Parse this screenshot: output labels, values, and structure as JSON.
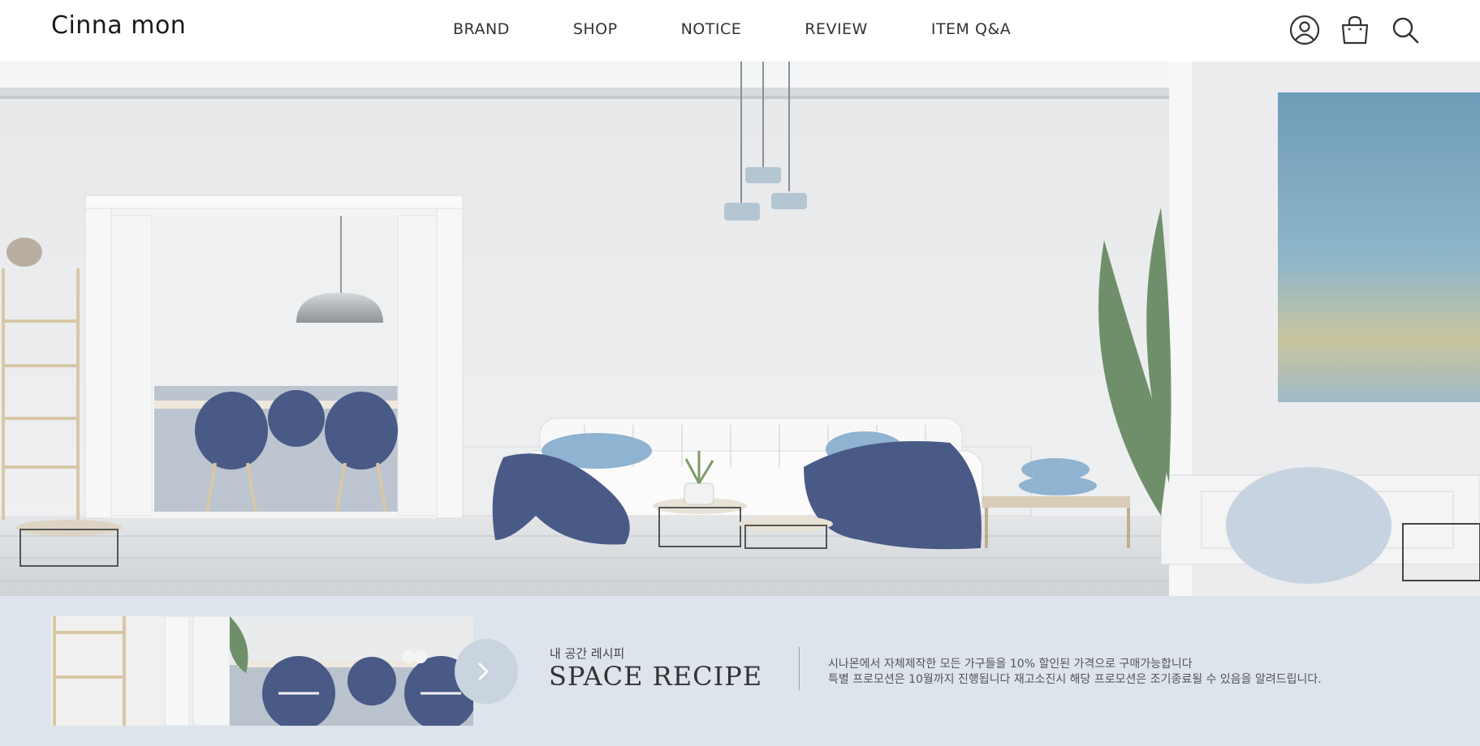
{
  "header": {
    "logo": "Cinna mon",
    "nav": [
      "BRAND",
      "SHOP",
      "NOTICE",
      "REVIEW",
      "ITEM Q&A"
    ],
    "icons": [
      "user-icon",
      "shopping-bag-icon",
      "search-icon"
    ]
  },
  "hero": {
    "image": "living-room-interior-illustration"
  },
  "promo": {
    "image": "dining-room-thumbnail",
    "arrow_icon": "chevron-right-icon",
    "subtitle": "내 공간 레시피",
    "title": "SPACE RECIPE",
    "description_line1": "시나몬에서 자체제작한 모든 가구들을 10% 할인된 가격으로 구매가능합니다",
    "description_line2": "특별 프로모션은 10월까지 진행됩니다 재고소진시 해당 프로모션은 조기종료될 수 있음을 알려드립니다."
  },
  "colors": {
    "promo_background": "#dde4ec",
    "accent_blue": "#4a5a86",
    "pillow_blue": "#8fb3d0"
  }
}
